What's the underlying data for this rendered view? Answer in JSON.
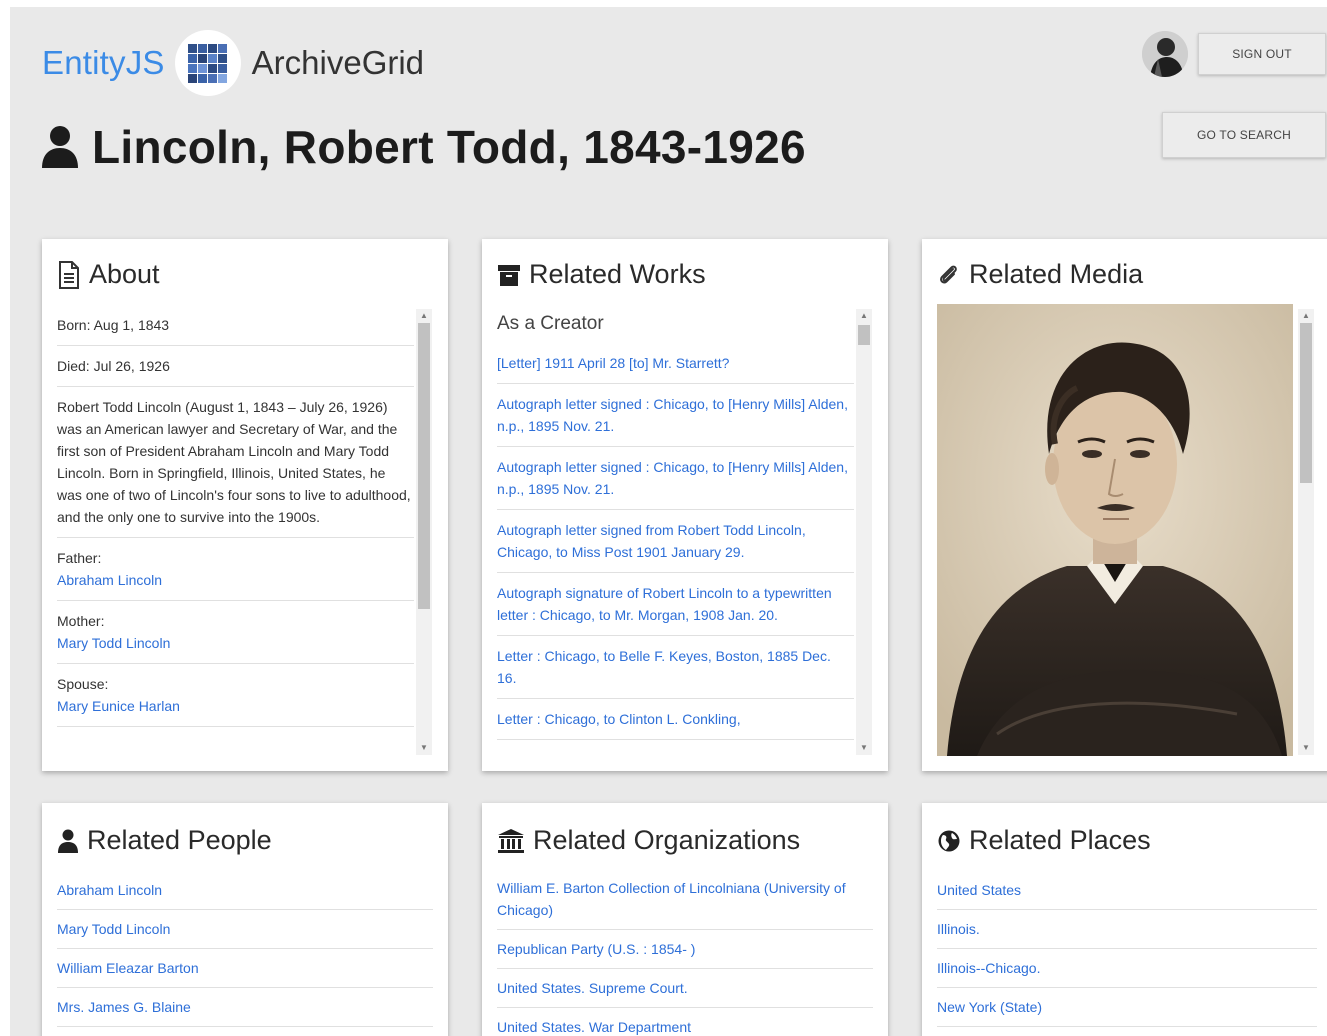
{
  "header": {
    "brand_primary": "EntityJS",
    "brand_secondary": "ArchiveGrid",
    "sign_out_label": "SIGN OUT",
    "go_to_search_label": "GO TO SEARCH"
  },
  "page": {
    "title": "Lincoln, Robert Todd, 1843-1926",
    "accent_color": "#3b8be6",
    "link_color": "#2e6fd8"
  },
  "about": {
    "heading": "About",
    "born": "Born: Aug 1, 1843",
    "died": "Died: Jul 26, 1926",
    "bio": "Robert Todd Lincoln (August 1, 1843 – July 26, 1926) was an American lawyer and Secretary of War, and the first son of President Abraham Lincoln and Mary Todd Lincoln. Born in Springfield, Illinois, United States, he was one of two of Lincoln's four sons to live to adulthood, and the only one to survive into the 1900s.",
    "father_label": "Father:",
    "father": "Abraham Lincoln",
    "mother_label": "Mother:",
    "mother": "Mary Todd Lincoln",
    "spouse_label": "Spouse:",
    "spouse": "Mary Eunice Harlan"
  },
  "works": {
    "heading": "Related Works",
    "subheading": "As a Creator",
    "items": [
      "[Letter] 1911 April 28 [to] Mr. Starrett?",
      "Autograph letter signed : Chicago, to [Henry Mills] Alden, n.p., 1895 Nov. 21.",
      "Autograph letter signed : Chicago, to [Henry Mills] Alden, n.p., 1895 Nov. 21.",
      "Autograph letter signed from Robert Todd Lincoln, Chicago, to Miss Post 1901 January 29.",
      "Autograph signature of Robert Lincoln to a typewritten letter : Chicago, to Mr. Morgan, 1908 Jan. 20.",
      "Letter : Chicago, to Belle F. Keyes, Boston, 1885 Dec. 16.",
      "Letter : Chicago, to Clinton L. Conkling,"
    ]
  },
  "media": {
    "heading": "Related Media"
  },
  "people": {
    "heading": "Related People",
    "items": [
      "Abraham Lincoln",
      "Mary Todd Lincoln",
      "William Eleazar Barton",
      "Mrs. James G. Blaine"
    ]
  },
  "organizations": {
    "heading": "Related Organizations",
    "items": [
      "William E. Barton Collection of Lincolniana (University of Chicago)",
      "Republican Party (U.S. : 1854- )",
      "United States. Supreme Court.",
      "United States. War Department"
    ]
  },
  "places": {
    "heading": "Related Places",
    "items": [
      "United States",
      "Illinois.",
      "Illinois--Chicago.",
      "New York (State)"
    ]
  },
  "icons": {
    "logo": "grid-logo-icon",
    "title": "person-icon",
    "about": "document-icon",
    "works": "archive-box-icon",
    "media": "paperclip-icon",
    "people": "person-icon",
    "organizations": "bank-icon",
    "places": "globe-icon"
  }
}
